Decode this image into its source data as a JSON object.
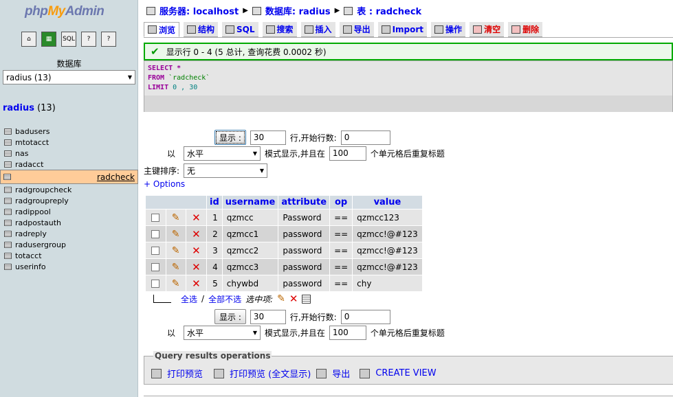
{
  "sidebar": {
    "logo": {
      "php": "php",
      "my": "My",
      "admin": "Admin"
    },
    "nav_icons": [
      "home-icon",
      "query-icon",
      "sql-icon",
      "docs-icon",
      "docs-icon-2"
    ],
    "db_label": "数据库",
    "db_select": "radius (13)",
    "db_heading": {
      "name": "radius",
      "count": "(13)"
    },
    "tables": [
      "badusers",
      "mtotacct",
      "nas",
      "radacct",
      "radcheck",
      "radgroupcheck",
      "radgroupreply",
      "radippool",
      "radpostauth",
      "radreply",
      "radusergroup",
      "totacct",
      "userinfo"
    ],
    "selected_table": "radcheck"
  },
  "breadcrumb": {
    "server_label": "服务器:",
    "server": "localhost",
    "db_label": "数据库:",
    "db": "radius",
    "table_label": "表 :",
    "table": "radcheck"
  },
  "tabs": [
    {
      "label": "浏览",
      "icon": "browse-icon",
      "active": true
    },
    {
      "label": "结构",
      "icon": "structure-icon"
    },
    {
      "label": "SQL",
      "icon": "sql-icon"
    },
    {
      "label": "搜索",
      "icon": "search-icon"
    },
    {
      "label": "插入",
      "icon": "insert-icon"
    },
    {
      "label": "导出",
      "icon": "export-icon"
    },
    {
      "label": "Import",
      "icon": "import-icon"
    },
    {
      "label": "操作",
      "icon": "operations-icon"
    },
    {
      "label": "清空",
      "icon": "empty-icon",
      "danger": true
    },
    {
      "label": "删除",
      "icon": "drop-icon",
      "danger": true
    }
  ],
  "message": "显示行 0 - 4 (5 总计, 查询花费 0.0002 秒)",
  "sql": {
    "line1_kw": "SELECT",
    "line1_rest": " *",
    "line2_kw": "FROM",
    "line2_rest": " `radcheck`",
    "line3_kw": "LIMIT",
    "line3_rest": " 0 , 30"
  },
  "nav": {
    "show_button": "显示 :",
    "rows_value": "30",
    "rows_label": "行,开始行数:",
    "start_value": "0",
    "in_label": "以",
    "mode_value": "水平",
    "mode_label": "模式显示,并且在",
    "repeat_value": "100",
    "repeat_label": "个单元格后重复标题"
  },
  "sort": {
    "label": "主键排序:",
    "value": "无"
  },
  "options_link": "+ Options",
  "columns": [
    "id",
    "username",
    "attribute",
    "op",
    "value"
  ],
  "rows": [
    {
      "id": "1",
      "username": "qzmcc",
      "attribute": "Password",
      "op": "==",
      "value": "qzmcc123"
    },
    {
      "id": "2",
      "username": "qzmcc1",
      "attribute": "password",
      "op": "==",
      "value": "qzmcc!@#123"
    },
    {
      "id": "3",
      "username": "qzmcc2",
      "attribute": "password",
      "op": "==",
      "value": "qzmcc!@#123"
    },
    {
      "id": "4",
      "username": "qzmcc3",
      "attribute": "password",
      "op": "==",
      "value": "qzmcc!@#123"
    },
    {
      "id": "5",
      "username": "chywbd",
      "attribute": "password",
      "op": "==",
      "value": "chy"
    }
  ],
  "selection": {
    "check_all": "全选",
    "sep": "/",
    "uncheck_all": "全部不选",
    "with_selected": "选中项:"
  },
  "qro": {
    "legend": "Query results operations",
    "print_view": "打印预览",
    "print_view_full": "打印预览 (全文显示)",
    "export": "导出",
    "create_view": "CREATE VIEW"
  },
  "colors": {
    "sidebar_bg": "#d0dce0",
    "selected_row": "#ffcc99",
    "link": "#0000ee",
    "success_border": "#00aa00",
    "header_bg": "#d3dce3"
  }
}
